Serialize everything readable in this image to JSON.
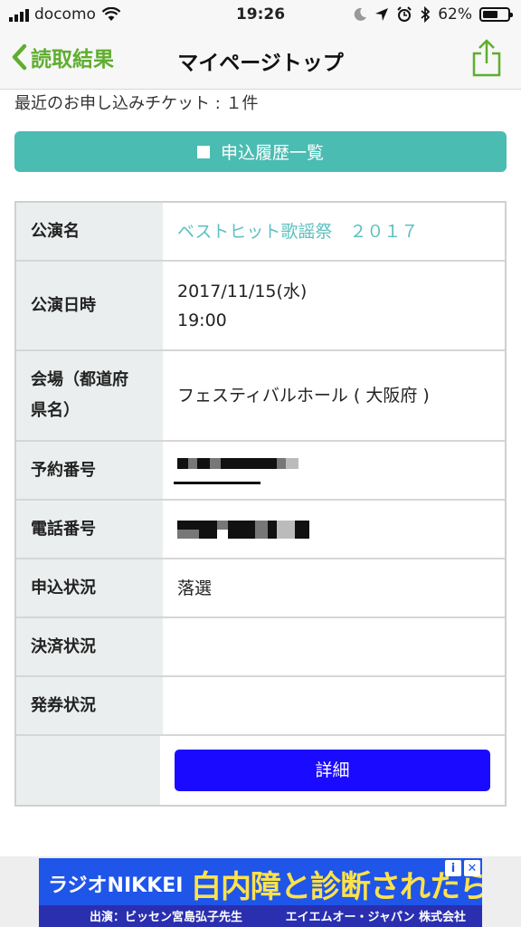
{
  "status_bar": {
    "carrier": "docomo",
    "time": "19:26",
    "battery_percent": "62%",
    "battery_level": 0.62
  },
  "nav": {
    "back_label": "読取結果",
    "title": "マイページトップ"
  },
  "summary": "最近のお申し込みチケット : １件",
  "history_button": "申込履歴一覧",
  "table": {
    "performance_label": "公演名",
    "performance_value": "ベストヒット歌謡祭　２０１７",
    "datetime_label": "公演日時",
    "date_value": "2017/11/15(水)",
    "time_value": "19:00",
    "venue_label_1": "会場（都道府",
    "venue_label_2": "県名）",
    "venue_value": "フェスティバルホール ( 大阪府 )",
    "reservation_label": "予約番号",
    "phone_label": "電話番号",
    "application_status_label": "申込状況",
    "application_status_value": "落選",
    "payment_status_label": "決済状況",
    "ticket_status_label": "発券状況",
    "detail_button": "詳細"
  },
  "ad": {
    "brand": "ラジオNIKKEI",
    "headline": "白内障と診断されたら",
    "left_text": "出演：ビッセン宮島弘子先生",
    "right_text": "エイエムオー・ジャパン 株式会社",
    "info_icon": "i",
    "close_icon": "✕"
  },
  "colors": {
    "accent_green": "#5fae2e",
    "teal_button": "#4bbcb2",
    "link_teal": "#5ec0c0",
    "detail_blue": "#1a0aff"
  }
}
